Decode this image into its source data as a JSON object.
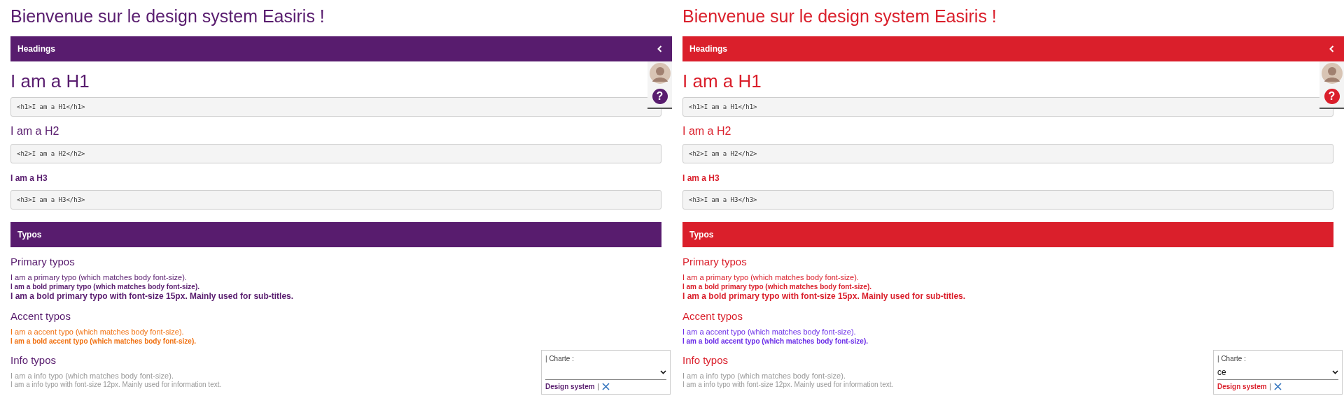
{
  "panels": [
    {
      "color": "#581c6e",
      "title": "Bienvenue sur le design system Easiris !",
      "side_tab": {
        "help": "?"
      },
      "sections": [
        {
          "kind": "headings",
          "label": "Headings",
          "items": [
            {
              "kind": "h1",
              "text": "I am a H1",
              "code": "<h1>I am a H1</h1>"
            },
            {
              "kind": "h2",
              "text": "I am a H2",
              "code": "<h2>I am a H2</h2>"
            },
            {
              "kind": "h3",
              "text": "I am a H3",
              "code": "<h3>I am a H3</h3>"
            }
          ]
        },
        {
          "kind": "typos",
          "label": "Typos",
          "groups": [
            {
              "title": "Primary typos",
              "lines": [
                {
                  "kind": "regular",
                  "color": "#581c6e",
                  "text": "I am a primary typo (which matches body font-size)."
                },
                {
                  "kind": "bold",
                  "color": "#581c6e",
                  "text": "I am a bold primary typo (which matches body font-size)."
                },
                {
                  "kind": "subtitle",
                  "color": "#581c6e",
                  "text": "I am a bold primary typo with font-size 15px. Mainly used for sub-titles."
                }
              ]
            },
            {
              "title": "Accent typos",
              "lines": [
                {
                  "kind": "regular",
                  "color": "#f07010",
                  "text": "I am a accent typo (which matches body font-size)."
                },
                {
                  "kind": "bold",
                  "color": "#f07010",
                  "text": "I am a bold accent typo (which matches body font-size)."
                }
              ]
            },
            {
              "title": "Info typos",
              "lines": [
                {
                  "kind": "regular",
                  "color": "#999999",
                  "text": "I am a info typo (which matches body font-size)."
                },
                {
                  "kind": "small",
                  "color": "#999999",
                  "text": "I am a info typo with font-size 12px. Mainly used for information text."
                }
              ]
            }
          ]
        }
      ],
      "charte": {
        "label": "| Charte :",
        "link": "Design system",
        "separator": "|"
      }
    },
    {
      "color": "#da1f2b",
      "title": "Bienvenue sur le design system Easiris !",
      "side_tab": {
        "help": "?"
      },
      "sections": [
        {
          "kind": "headings",
          "label": "Headings",
          "items": [
            {
              "kind": "h1",
              "text": "I am a H1",
              "code": "<h1>I am a H1</h1>"
            },
            {
              "kind": "h2",
              "text": "I am a H2",
              "code": "<h2>I am a H2</h2>"
            },
            {
              "kind": "h3",
              "text": "I am a H3",
              "code": "<h3>I am a H3</h3>"
            }
          ]
        },
        {
          "kind": "typos",
          "label": "Typos",
          "groups": [
            {
              "title": "Primary typos",
              "lines": [
                {
                  "kind": "regular",
                  "color": "#da1f2b",
                  "text": "I am a primary typo (which matches body font-size)."
                },
                {
                  "kind": "bold",
                  "color": "#da1f2b",
                  "text": "I am a bold primary typo (which matches body font-size)."
                },
                {
                  "kind": "subtitle",
                  "color": "#da1f2b",
                  "text": "I am a bold primary typo with font-size 15px. Mainly used for sub-titles."
                }
              ]
            },
            {
              "title": "Accent typos",
              "lines": [
                {
                  "kind": "regular",
                  "color": "#6a2ce8",
                  "text": "I am a accent typo (which matches body font-size)."
                },
                {
                  "kind": "bold",
                  "color": "#6a2ce8",
                  "text": "I am a bold accent typo (which matches body font-size)."
                }
              ]
            },
            {
              "title": "Info typos",
              "lines": [
                {
                  "kind": "regular",
                  "color": "#999999",
                  "text": "I am a info typo (which matches body font-size)."
                },
                {
                  "kind": "small",
                  "color": "#999999",
                  "text": "I am a info typo with font-size 12px. Mainly used for information text."
                }
              ]
            }
          ]
        }
      ],
      "charte": {
        "label": "| Charte :",
        "value": "ce",
        "link": "Design system",
        "separator": "|"
      }
    }
  ]
}
